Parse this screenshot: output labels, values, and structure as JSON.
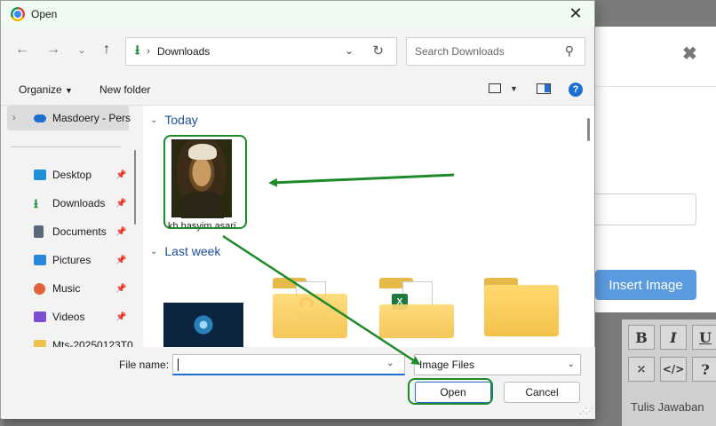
{
  "background": {
    "insert_button": "Insert Image",
    "editor_tools": [
      "B",
      "I",
      "U",
      "⤫",
      "</>",
      "?"
    ],
    "editor_placeholder": "Tulis Jawaban"
  },
  "dialog": {
    "title": "Open",
    "nav": {
      "address_path": "Downloads",
      "search_placeholder": "Search Downloads"
    },
    "toolbar": {
      "organize_label": "Organize",
      "new_folder_label": "New folder"
    },
    "sidebar": {
      "cloud_item": "Masdoery - Pers",
      "items": [
        {
          "label": "Desktop",
          "icon": "desktop-icon",
          "color": "#1e8fd8"
        },
        {
          "label": "Downloads",
          "icon": "download-icon",
          "color": "#1a8c3c"
        },
        {
          "label": "Documents",
          "icon": "document-icon",
          "color": "#5b6a7a"
        },
        {
          "label": "Pictures",
          "icon": "pictures-icon",
          "color": "#2a86d8"
        },
        {
          "label": "Music",
          "icon": "music-icon",
          "color": "#e0623a"
        },
        {
          "label": "Videos",
          "icon": "videos-icon",
          "color": "#7b4fd0"
        },
        {
          "label": "Mts-20250123T0",
          "icon": "folder-icon",
          "color": "#f0c24b"
        }
      ]
    },
    "groups": [
      {
        "heading": "Today",
        "files": [
          {
            "name": "kh hasyim asari",
            "type": "image"
          }
        ]
      },
      {
        "heading": "Last week",
        "files": [
          {
            "name": "",
            "type": "image"
          },
          {
            "name": "",
            "type": "folder-pdf"
          },
          {
            "name": "",
            "type": "folder-excel"
          },
          {
            "name": "",
            "type": "folder"
          }
        ]
      }
    ],
    "footer": {
      "file_name_label": "File name:",
      "file_name_value": "",
      "file_type_selected": "Image Files",
      "open_label": "Open",
      "cancel_label": "Cancel"
    },
    "colors": {
      "highlight": "#1f8a2a",
      "accent": "#1e6fd0",
      "group_heading": "#1d4e9a"
    }
  }
}
